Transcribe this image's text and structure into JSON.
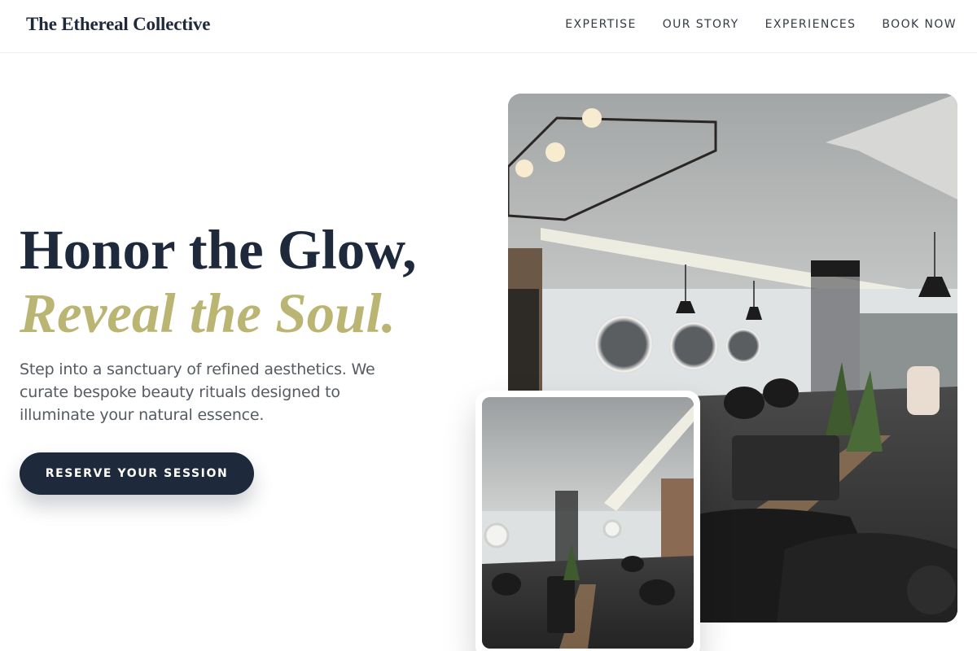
{
  "header": {
    "brand": "The Ethereal Collective",
    "nav": [
      "EXPERTISE",
      "OUR STORY",
      "EXPERIENCES",
      "BOOK NOW"
    ]
  },
  "hero": {
    "headline_line1": "Honor the Glow,",
    "headline_line2": "Reveal the Soul.",
    "lead": "Step into a sanctuary of refined aesthetics. We curate bespoke beauty rituals designed to illuminate your natural essence.",
    "cta_label": "RESERVE YOUR SESSION"
  },
  "colors": {
    "navy": "#1e293b",
    "gold": "#bbb574",
    "muted_text": "#555b63"
  }
}
